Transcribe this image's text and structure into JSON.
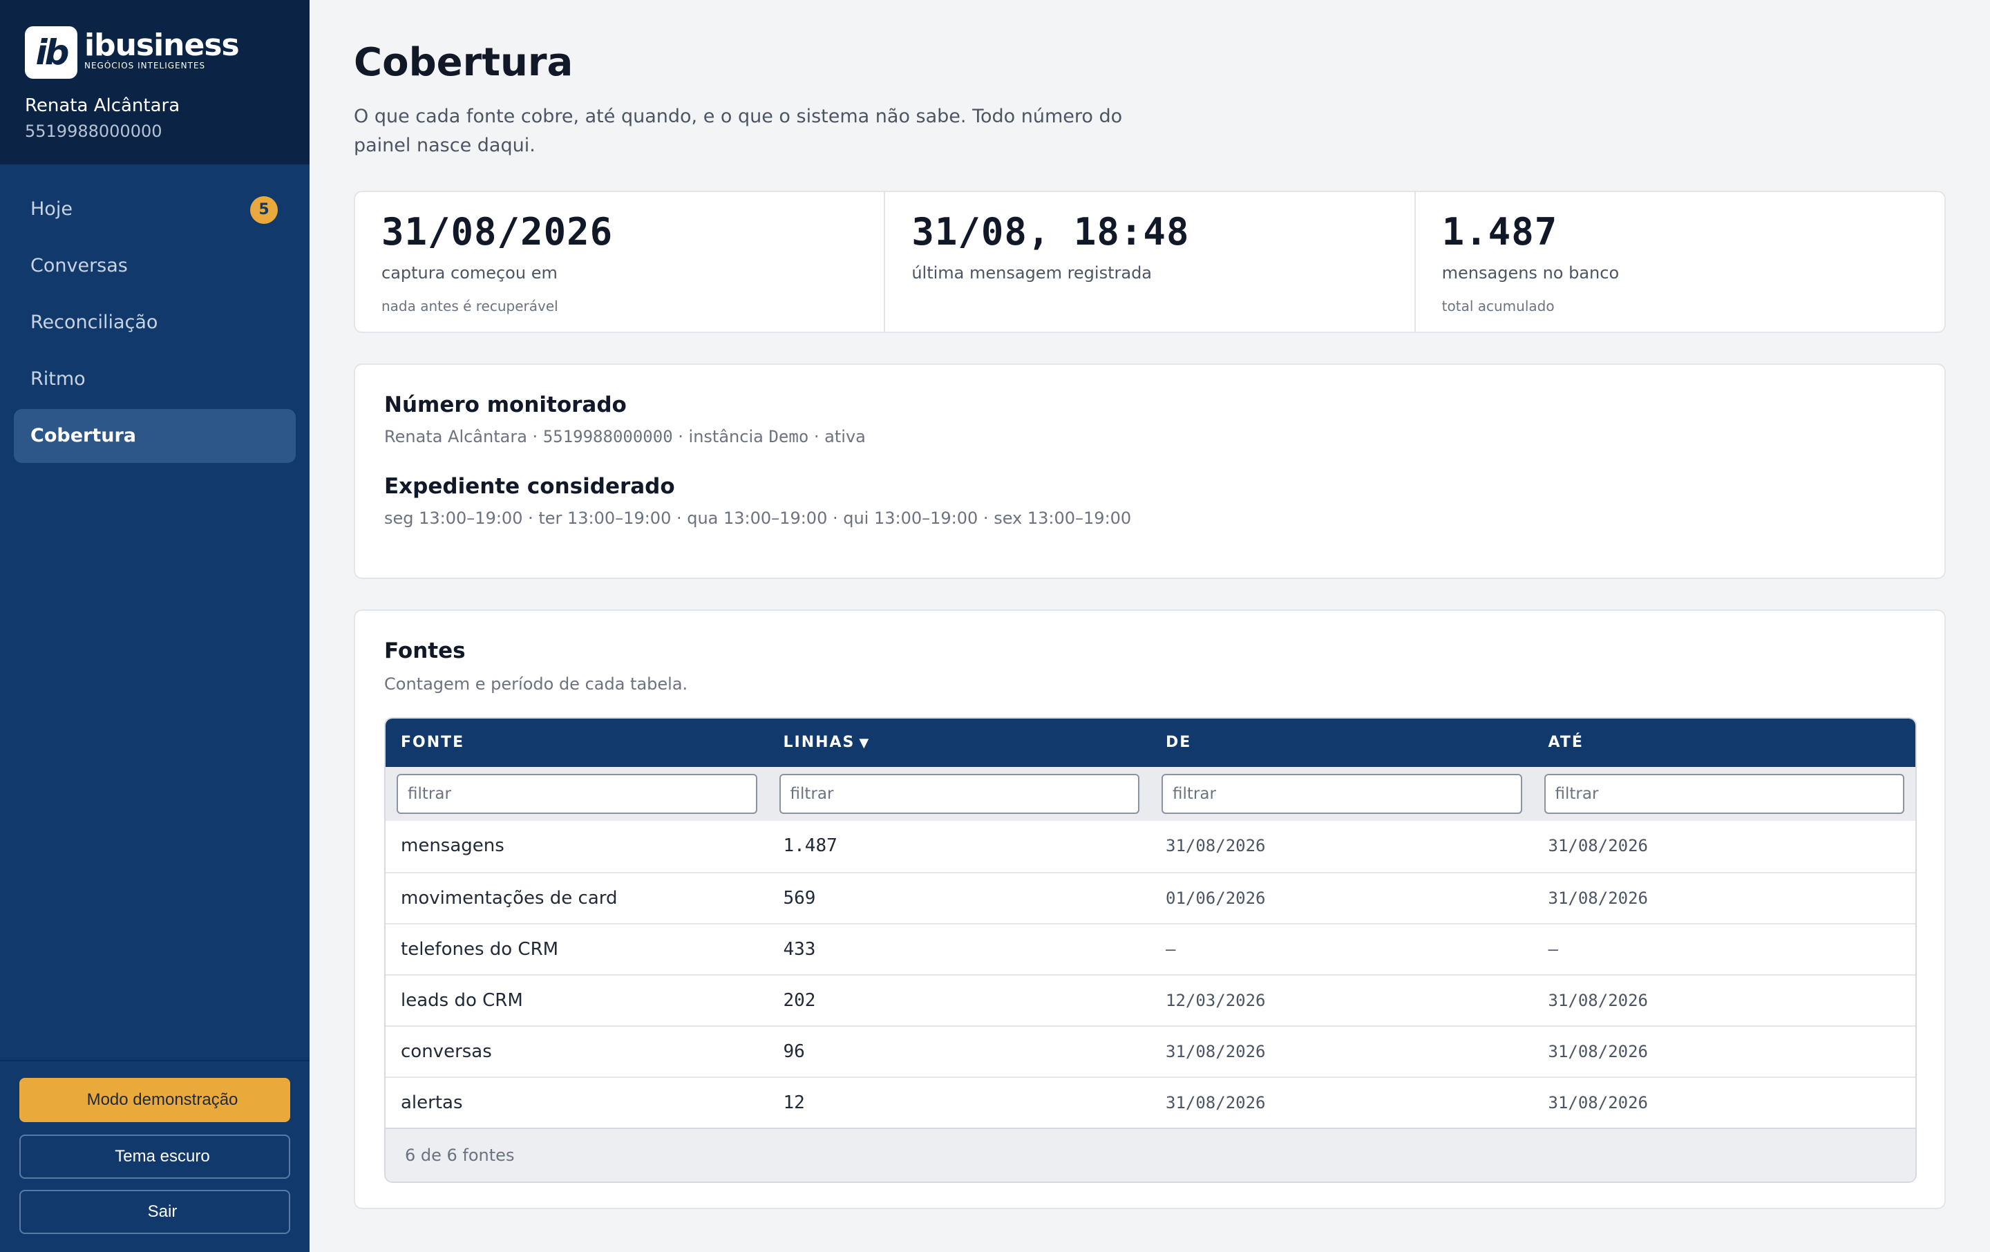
{
  "brand": {
    "mark": "ib",
    "name": "ibusiness",
    "tagline": "NEGÓCIOS INTELIGENTES"
  },
  "user": {
    "name": "Renata Alcântara",
    "phone": "5519988000000"
  },
  "nav": [
    {
      "label": "Hoje",
      "badge": "5"
    },
    {
      "label": "Conversas"
    },
    {
      "label": "Reconciliação"
    },
    {
      "label": "Ritmo"
    },
    {
      "label": "Cobertura",
      "active": true
    }
  ],
  "sidebar_buttons": {
    "demo": "Modo demonstração",
    "theme": "Tema escuro",
    "logout": "Sair"
  },
  "page": {
    "title": "Cobertura",
    "subtitle": "O que cada fonte cobre, até quando, e o que o sistema não sabe. Todo número do painel nasce daqui."
  },
  "stats": [
    {
      "value": "31/08/2026",
      "label": "captura começou em",
      "note": "nada antes é recuperável"
    },
    {
      "value": "31/08, 18:48",
      "label": "última mensagem registrada",
      "note": ""
    },
    {
      "value": "1.487",
      "label": "mensagens no banco",
      "note": "total acumulado"
    }
  ],
  "monitored": {
    "title": "Número monitorado",
    "name": "Renata Alcântara",
    "phone": "5519988000000",
    "instance_prefix": "instância",
    "instance": "Demo",
    "status": "ativa"
  },
  "schedule": {
    "title": "Expediente considerado",
    "text": "seg 13:00–19:00 · ter 13:00–19:00 · qua 13:00–19:00 · qui 13:00–19:00 · sex 13:00–19:00"
  },
  "sources": {
    "title": "Fontes",
    "subtitle": "Contagem e período de cada tabela.",
    "columns": [
      "FONTE",
      "LINHAS",
      "DE",
      "ATÉ"
    ],
    "filter_placeholder": "filtrar",
    "rows": [
      {
        "fonte": "mensagens",
        "linhas": "1.487",
        "de": "31/08/2026",
        "ate": "31/08/2026"
      },
      {
        "fonte": "movimentações de card",
        "linhas": "569",
        "de": "01/06/2026",
        "ate": "31/08/2026"
      },
      {
        "fonte": "telefones do CRM",
        "linhas": "433",
        "de": "–",
        "ate": "–"
      },
      {
        "fonte": "leads do CRM",
        "linhas": "202",
        "de": "12/03/2026",
        "ate": "31/08/2026"
      },
      {
        "fonte": "conversas",
        "linhas": "96",
        "de": "31/08/2026",
        "ate": "31/08/2026"
      },
      {
        "fonte": "alertas",
        "linhas": "12",
        "de": "31/08/2026",
        "ate": "31/08/2026"
      }
    ],
    "footer": "6 de 6 fontes"
  },
  "colors": {
    "sidebar": "#12396b",
    "sidebar_head": "#0b2446",
    "accent": "#e9a93b",
    "active_nav": "#2d5689"
  }
}
